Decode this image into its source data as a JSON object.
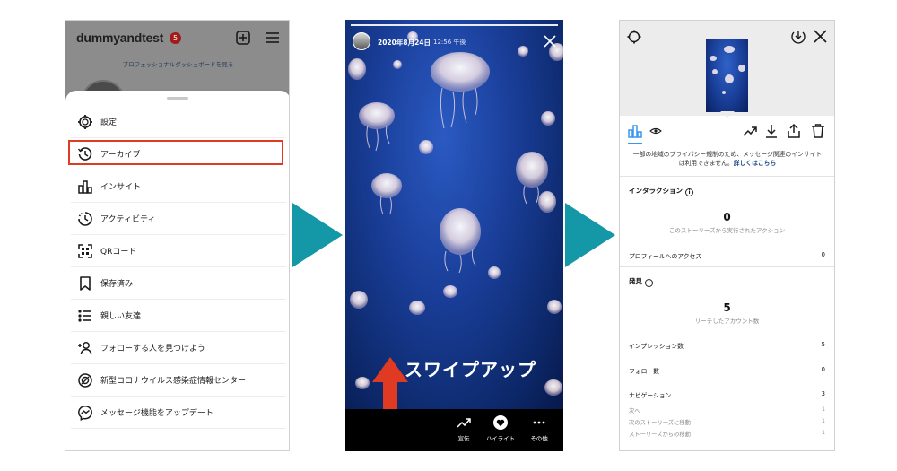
{
  "profile": {
    "username": "dummyandtest",
    "notification_count": "5",
    "dashboard_link": "プロフェッショナルダッシュボードを見る",
    "menu": [
      {
        "label": "設定",
        "icon": "settings-icon"
      },
      {
        "label": "アーカイブ",
        "icon": "archive-icon"
      },
      {
        "label": "インサイト",
        "icon": "insights-icon"
      },
      {
        "label": "アクティビティ",
        "icon": "activity-icon"
      },
      {
        "label": "QRコード",
        "icon": "qr-code-icon"
      },
      {
        "label": "保存済み",
        "icon": "bookmark-icon"
      },
      {
        "label": "親しい友達",
        "icon": "close-friends-icon"
      },
      {
        "label": "フォローする人を見つけよう",
        "icon": "add-person-icon"
      },
      {
        "label": "新型コロナウイルス感染症情報センター",
        "icon": "covid-info-icon"
      },
      {
        "label": "メッセージ機能をアップデート",
        "icon": "messenger-icon"
      }
    ],
    "highlight_color": "#e03a22"
  },
  "story": {
    "date": "2020年8月24日",
    "time": "12:56 午後",
    "overlay_text": "スワイプアップ",
    "actions": [
      {
        "label": "宣伝",
        "icon": "trend-icon"
      },
      {
        "label": "ハイライト",
        "icon": "heart-icon"
      },
      {
        "label": "その他",
        "icon": "more-icon"
      }
    ],
    "arrow_color": "#e03a22"
  },
  "insights": {
    "notice_text": "一部の地域のプライバシー規制のため、メッセージ関連のインサイトは利用できません。",
    "notice_link": "詳しくはこちら",
    "interaction": {
      "title": "インタラクション",
      "total": "0",
      "caption": "このストーリーズから実行されたアクション",
      "rows": [
        {
          "label": "プロフィールへのアクセス",
          "value": "0"
        }
      ]
    },
    "discovery": {
      "title": "発見",
      "total": "5",
      "caption": "リーチしたアカウント数",
      "rows": [
        {
          "label": "インプレッション数",
          "value": "5"
        },
        {
          "label": "フォロー数",
          "value": "0"
        },
        {
          "label": "ナビゲーション",
          "value": "3"
        }
      ],
      "sub_rows": [
        {
          "label": "次へ",
          "value": "1"
        },
        {
          "label": "次のストーリーズに移動",
          "value": "1"
        },
        {
          "label": "ストーリーズからの移動",
          "value": "1"
        }
      ]
    },
    "accent_color": "#3897f0"
  },
  "connector_arrow_color": "#1497a6"
}
